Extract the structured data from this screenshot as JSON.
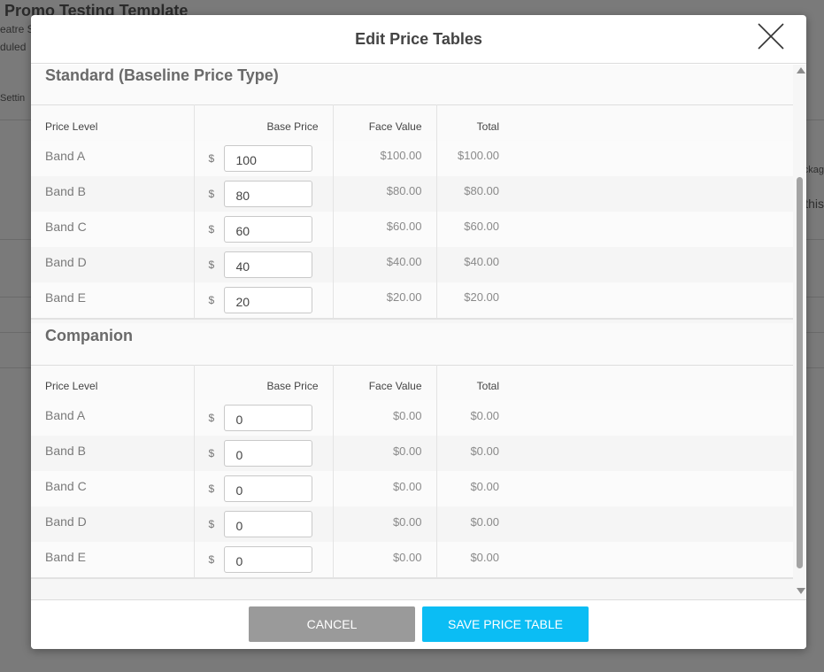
{
  "background": {
    "title": "Promo Testing Template",
    "subtitle1": "eatre S",
    "subtitle2": "duled",
    "settings_fragment": "Settin",
    "right_fragment1": "ckag",
    "right_fragment2": "this"
  },
  "modal": {
    "title": "Edit Price Tables",
    "close_icon": "close-icon",
    "columns": {
      "price_level": "Price Level",
      "base_price": "Base Price",
      "face_value": "Face Value",
      "total": "Total"
    },
    "currency_symbol": "$",
    "sections": [
      {
        "title": "Standard (Baseline Price Type)",
        "rows": [
          {
            "level": "Band A",
            "base_price": "100",
            "face_value": "$100.00",
            "total": "$100.00"
          },
          {
            "level": "Band B",
            "base_price": "80",
            "face_value": "$80.00",
            "total": "$80.00"
          },
          {
            "level": "Band C",
            "base_price": "60",
            "face_value": "$60.00",
            "total": "$60.00"
          },
          {
            "level": "Band D",
            "base_price": "40",
            "face_value": "$40.00",
            "total": "$40.00"
          },
          {
            "level": "Band E",
            "base_price": "20",
            "face_value": "$20.00",
            "total": "$20.00"
          }
        ]
      },
      {
        "title": "Companion",
        "rows": [
          {
            "level": "Band A",
            "base_price": "0",
            "face_value": "$0.00",
            "total": "$0.00"
          },
          {
            "level": "Band B",
            "base_price": "0",
            "face_value": "$0.00",
            "total": "$0.00"
          },
          {
            "level": "Band C",
            "base_price": "0",
            "face_value": "$0.00",
            "total": "$0.00"
          },
          {
            "level": "Band D",
            "base_price": "0",
            "face_value": "$0.00",
            "total": "$0.00"
          },
          {
            "level": "Band E",
            "base_price": "0",
            "face_value": "$0.00",
            "total": "$0.00"
          }
        ]
      }
    ],
    "footer": {
      "cancel_label": "CANCEL",
      "save_label": "SAVE PRICE TABLE"
    }
  },
  "colors": {
    "overlay": "#7a7a7a",
    "save_button": "#0bbdf4",
    "cancel_button": "#9a9a9a"
  }
}
